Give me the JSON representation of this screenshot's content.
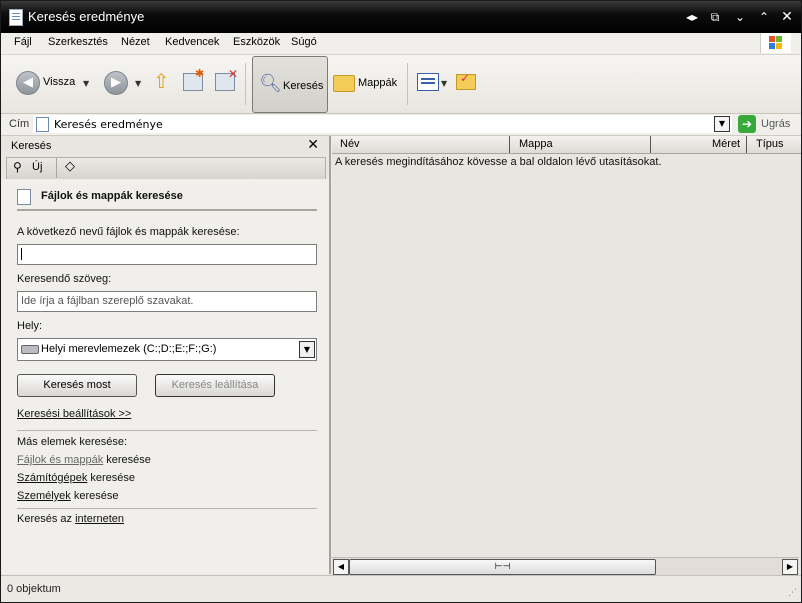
{
  "window": {
    "title": "Keresés eredménye",
    "controls": [
      "restore-left-right",
      "restore",
      "minimize",
      "maximize",
      "close"
    ]
  },
  "menubar": {
    "items": [
      "Fájl",
      "Szerkesztés",
      "Nézet",
      "Kedvencek",
      "Eszközök",
      "Súgó"
    ]
  },
  "toolbar": {
    "back_label": "Vissza",
    "search_label": "Keresés",
    "folders_label": "Mappák"
  },
  "address": {
    "label": "Cím",
    "value": "Keresés eredménye",
    "go_label": "Ugrás"
  },
  "search_pane": {
    "title": "Keresés",
    "new_label": "Új",
    "section_title": "Fájlok és mappák keresése",
    "filename_label": "A következő nevű fájlok és mappák keresése:",
    "filename_value": "",
    "text_label": "Keresendő szöveg:",
    "text_placeholder": "Ide írja a fájlban szereplő szavakat.",
    "location_label": "Hely:",
    "location_value": "Helyi merevlemezek (C:;D:;E:;F:;G:)",
    "search_now": "Keresés most",
    "stop_search": "Keresés leállítása",
    "options_link": "Keresési beállítások  >>",
    "other_heading": "Más elemek keresése:",
    "other_items": [
      {
        "link": "Fájlok és mappák",
        "suffix": " keresése"
      },
      {
        "link": "Számítógépek",
        "suffix": " keresése"
      },
      {
        "link": "Személyek",
        "suffix": " keresése"
      }
    ],
    "internet_prefix": "Keresés az ",
    "internet_link": "interneten"
  },
  "results": {
    "columns": [
      "Név",
      "Mappa",
      "Méret",
      "Típus"
    ],
    "message": "A keresés megindításához kövesse a bal oldalon lévő utasításokat."
  },
  "status": {
    "text": "0 objektum"
  },
  "colors": {
    "title_bar": "#000000",
    "go_green": "#3aa93c",
    "folder_yellow": "#f3cd58"
  }
}
